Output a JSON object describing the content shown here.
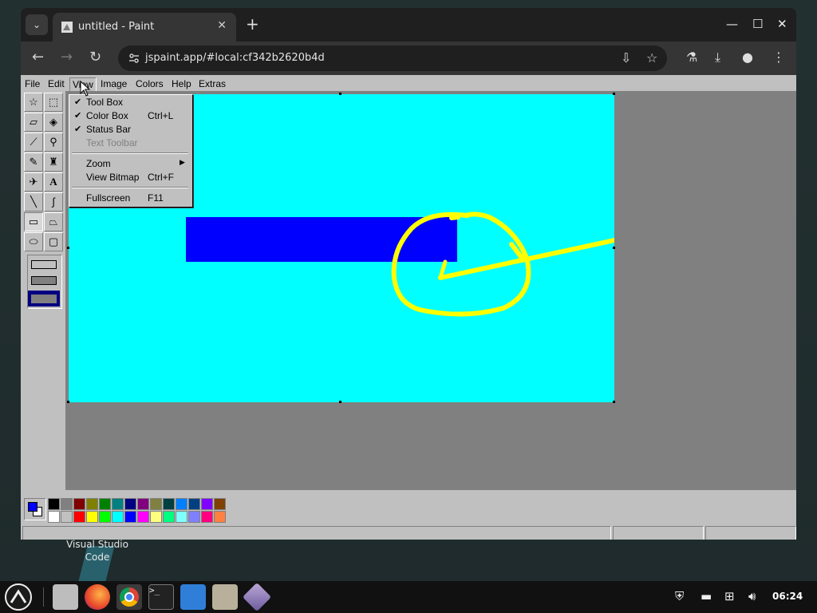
{
  "browser": {
    "tab_title": "untitled - Paint",
    "url": "jspaint.app/#local:cf342b2620b4d"
  },
  "menubar": {
    "file": "File",
    "edit": "Edit",
    "view": "View",
    "image": "Image",
    "colors": "Colors",
    "help": "Help",
    "extras": "Extras"
  },
  "view_menu": {
    "items": [
      {
        "label": "Tool Box",
        "checked": true,
        "shortcut": ""
      },
      {
        "label": "Color Box",
        "checked": true,
        "shortcut": "Ctrl+L"
      },
      {
        "label": "Status Bar",
        "checked": true,
        "shortcut": ""
      },
      {
        "label": "Text Toolbar",
        "checked": false,
        "shortcut": "",
        "disabled": true
      },
      {
        "label": "Zoom",
        "submenu": true
      },
      {
        "label": "View Bitmap",
        "shortcut": "Ctrl+F"
      },
      {
        "label": "Fullscreen",
        "shortcut": "F11"
      }
    ]
  },
  "canvas": {
    "background": "#00ffff",
    "rectangle_color": "#0000ff",
    "stroke_color": "#ffff00"
  },
  "colors": {
    "foreground": "#0000ff",
    "background": "#ffffff",
    "palette_top": [
      "#000000",
      "#808080",
      "#800000",
      "#808000",
      "#008000",
      "#008080",
      "#000080",
      "#800080",
      "#808040",
      "#004040",
      "#0080ff",
      "#004080",
      "#8000ff",
      "#804000"
    ],
    "palette_bottom": [
      "#ffffff",
      "#c0c0c0",
      "#ff0000",
      "#ffff00",
      "#00ff00",
      "#00ffff",
      "#0000ff",
      "#ff00ff",
      "#ffff80",
      "#00ff80",
      "#80ffff",
      "#8080ff",
      "#ff0080",
      "#ff8040"
    ]
  },
  "desktop": {
    "icon_label": "Visual Studio Code"
  },
  "taskbar": {
    "clock": "06:24"
  }
}
